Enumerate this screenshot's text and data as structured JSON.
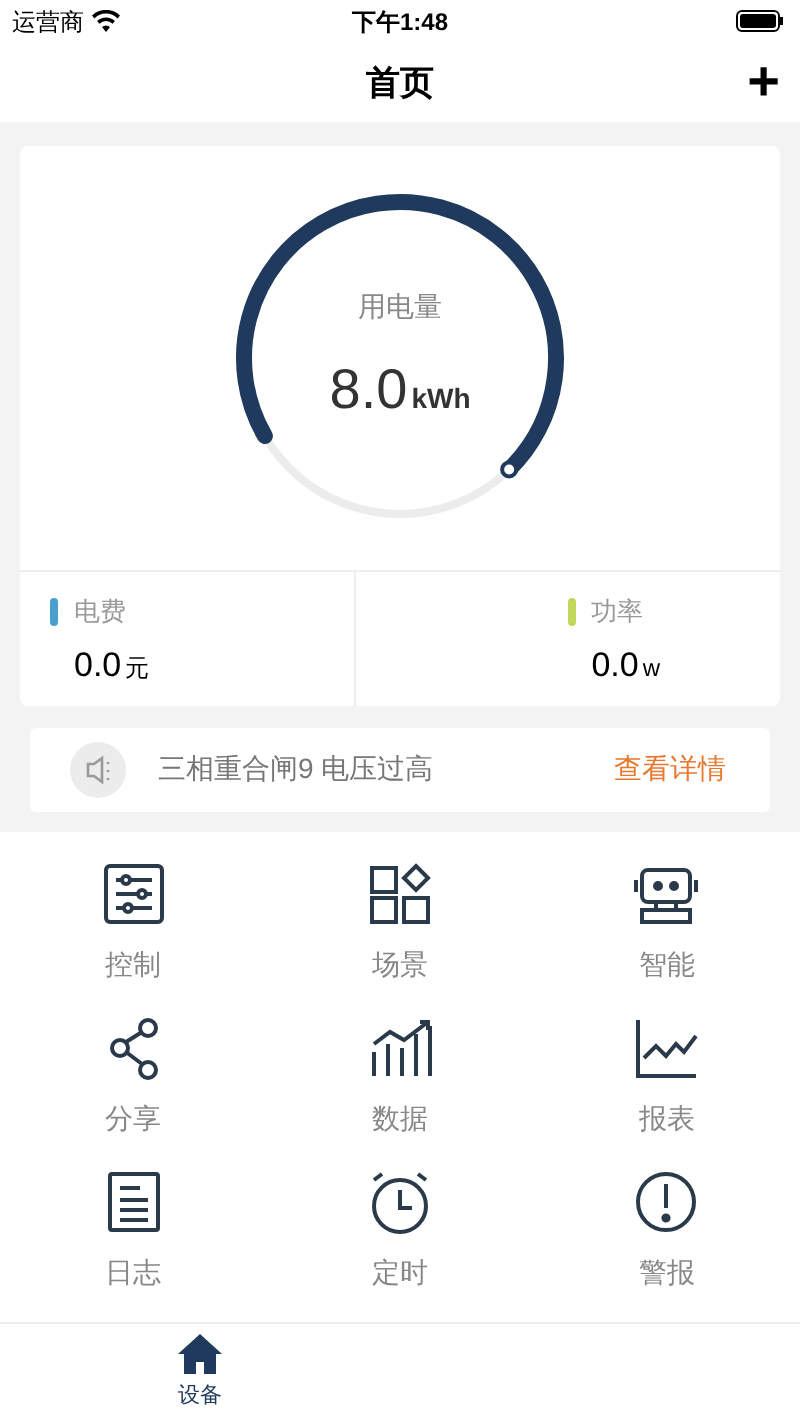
{
  "status_bar": {
    "carrier": "运营商",
    "time": "下午1:48"
  },
  "header": {
    "title": "首页",
    "add_button": "+"
  },
  "gauge": {
    "label": "用电量",
    "value": "8.0",
    "unit": "kWh",
    "level": 0.71
  },
  "stats": [
    {
      "label": "电费",
      "value": "0.0",
      "unit": "元",
      "color": "#4a9fd0"
    },
    {
      "label": "功率",
      "value": "0.0",
      "unit": "w",
      "color": "#c2d85a"
    }
  ],
  "notice": {
    "text": "三相重合闸9 电压过高",
    "link": "查看详情"
  },
  "functions": [
    {
      "kind": "control",
      "label": "控制"
    },
    {
      "kind": "scene",
      "label": "场景"
    },
    {
      "kind": "smart",
      "label": "智能"
    },
    {
      "kind": "share",
      "label": "分享"
    },
    {
      "kind": "data",
      "label": "数据"
    },
    {
      "kind": "report",
      "label": "报表"
    },
    {
      "kind": "log",
      "label": "日志"
    },
    {
      "kind": "timer",
      "label": "定时"
    },
    {
      "kind": "alarm",
      "label": "警报"
    }
  ],
  "tab_bar": [
    {
      "label": "设备",
      "selected": true
    }
  ]
}
